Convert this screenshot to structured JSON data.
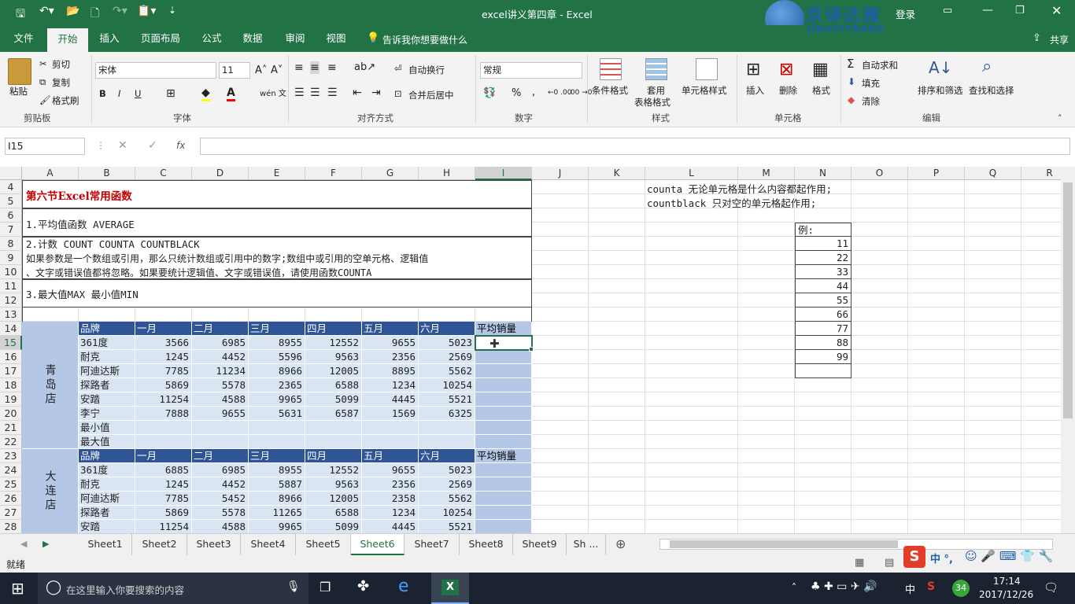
{
  "window": {
    "doc_title": "excel讲义第四章 - Excel",
    "user": "登录",
    "logo_cn": "京译达雅",
    "logo_en": "JINGYITRANS"
  },
  "tabs": [
    {
      "label": "文件",
      "active": false
    },
    {
      "label": "开始",
      "active": true
    },
    {
      "label": "插入",
      "active": false
    },
    {
      "label": "页面布局",
      "active": false
    },
    {
      "label": "公式",
      "active": false
    },
    {
      "label": "数据",
      "active": false
    },
    {
      "label": "审阅",
      "active": false
    },
    {
      "label": "视图",
      "active": false
    }
  ],
  "tell_me": "告诉我你想要做什么",
  "share": "共享",
  "ribbon": {
    "paste": "粘贴",
    "cut": "剪切",
    "copy": "复制",
    "format_painter": "格式刷",
    "clipboard": "剪贴板",
    "font_name": "宋体",
    "font_size": "11",
    "font_group": "字体",
    "bold": "B",
    "italic": "I",
    "underline": "U",
    "wen": "wén 文",
    "wrap": "自动换行",
    "merge": "合并后居中",
    "align_group": "对齐方式",
    "number_format": "常规",
    "pct": "%",
    "comma": ",",
    "inc_dec": "←0 .00",
    "dec_dec": ".00 →0",
    "number_group": "数字",
    "cond_format": "条件格式",
    "table_format_1": "套用",
    "table_format_2": "表格格式",
    "cell_style": "单元格样式",
    "style_group": "样式",
    "insert": "插入",
    "delete": "删除",
    "format": "格式",
    "cells_group": "单元格",
    "autosum": "自动求和",
    "fill": "填充",
    "clear": "清除",
    "sort": "排序和筛选",
    "find": "查找和选择",
    "edit_group": "编辑"
  },
  "formula_bar": {
    "name_box": "I15",
    "formula": "",
    "fx": "fx"
  },
  "columns": [
    "A",
    "B",
    "C",
    "D",
    "E",
    "F",
    "G",
    "H",
    "I",
    "J",
    "K",
    "L",
    "M",
    "N",
    "O",
    "P",
    "Q",
    "R"
  ],
  "rows": [
    "4",
    "5",
    "6",
    "7",
    "8",
    "9",
    "10",
    "11",
    "12",
    "13",
    "14",
    "15",
    "16",
    "17",
    "18",
    "19",
    "20",
    "21",
    "22",
    "23",
    "24",
    "25",
    "26",
    "27",
    "28"
  ],
  "text_rows": {
    "r4": "第六节Excel常用函数",
    "r6": "1.平均值函数 AVERAGE",
    "r8": "2.计数 COUNT  COUNTA  COUNTBLACK",
    "r9": "如果参数是一个数组或引用，那么只统计数组或引用中的数字;数组中或引用的空单元格、逻辑值",
    "r10": "、文字或错误值都将忽略。如果要统计逻辑值、文字或错误值，请使用函数COUNTA",
    "r12": "3.最大值MAX 最小值MIN"
  },
  "notes": {
    "l4": "counta 无论单元格是什么内容都起作用;",
    "l5": "countblack 只对空的单元格起作用;"
  },
  "example": {
    "label": "例:",
    "values": [
      "11",
      "22",
      "33",
      "44",
      "55",
      "66",
      "77",
      "88",
      "99"
    ]
  },
  "table_header": [
    "品牌",
    "一月",
    "二月",
    "三月",
    "四月",
    "五月",
    "六月",
    "平均销量"
  ],
  "store1": {
    "name": "青岛店",
    "rows": [
      [
        "361度",
        "3566",
        "6985",
        "8955",
        "12552",
        "9655",
        "5023"
      ],
      [
        "耐克",
        "1245",
        "4452",
        "5596",
        "9563",
        "2356",
        "2569"
      ],
      [
        "阿迪达斯",
        "7785",
        "11234",
        "8966",
        "12005",
        "8895",
        "5562"
      ],
      [
        "探路者",
        "5869",
        "5578",
        "2365",
        "6588",
        "1234",
        "10254"
      ],
      [
        "安踏",
        "11254",
        "4588",
        "9965",
        "5099",
        "4445",
        "5521"
      ],
      [
        "李宁",
        "7888",
        "9655",
        "5631",
        "6587",
        "1569",
        "6325"
      ]
    ],
    "min_label": "最小值",
    "max_label": "最大值"
  },
  "store2": {
    "name": "大连店",
    "rows": [
      [
        "361度",
        "6885",
        "6985",
        "8955",
        "12552",
        "9655",
        "5023"
      ],
      [
        "耐克",
        "1245",
        "4452",
        "5887",
        "9563",
        "2356",
        "2569"
      ],
      [
        "阿迪达斯",
        "7785",
        "5452",
        "8966",
        "12005",
        "2358",
        "5562"
      ],
      [
        "探路者",
        "5869",
        "5578",
        "11265",
        "6588",
        "1234",
        "10254"
      ],
      [
        "安踏",
        "11254",
        "4588",
        "9965",
        "5099",
        "4445",
        "5521"
      ]
    ]
  },
  "sheets": [
    {
      "label": "Sheet1",
      "active": false
    },
    {
      "label": "Sheet2",
      "active": false
    },
    {
      "label": "Sheet3",
      "active": false
    },
    {
      "label": "Sheet4",
      "active": false
    },
    {
      "label": "Sheet5",
      "active": false
    },
    {
      "label": "Sheet6",
      "active": true
    },
    {
      "label": "Sheet7",
      "active": false
    },
    {
      "label": "Sheet8",
      "active": false
    },
    {
      "label": "Sheet9",
      "active": false
    },
    {
      "label": "Sh ...",
      "active": false
    }
  ],
  "status": {
    "ready": "就绪",
    "ime": "中 °,"
  },
  "taskbar": {
    "search_placeholder": "在这里输入你要搜索的内容",
    "time": "17:14",
    "date": "2017/12/26",
    "ime": "中",
    "badge": "34"
  },
  "colors": {
    "accent": "#217346",
    "header_blue": "#2f5597",
    "light_blue": "#d9e5f2",
    "avg_blue": "#b4c7e7",
    "title_red": "#c00000"
  }
}
